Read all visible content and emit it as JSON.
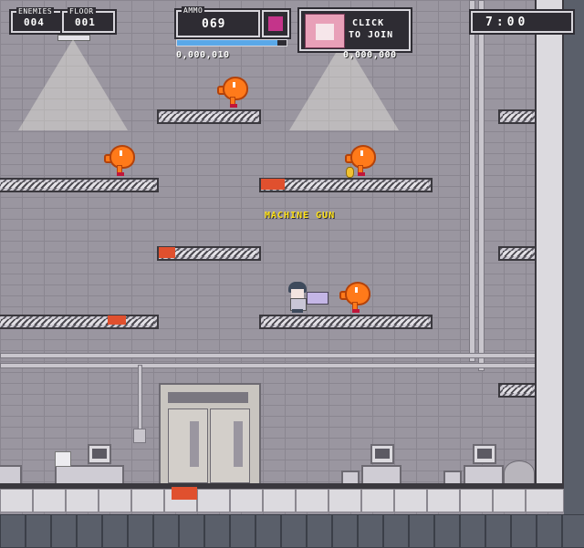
{
  "hud": {
    "enemies_label": "ENEMIES",
    "enemies_value": "004",
    "floor_label": "FLOOR",
    "floor_value": "001",
    "ammo_label": "AMMO",
    "ammo_value": "069",
    "player1_score": "0,000,010",
    "player2_score": "0,000,000",
    "join_line1": "CLICK",
    "join_line2": "TO JOIN",
    "timer_value": "7:00"
  },
  "game": {
    "weapon_pickup_label": "MACHINE GUN",
    "ammo_fraction": 0.92
  },
  "colors": {
    "enemy": "#ff7a1a",
    "blood": "#e0502e",
    "hud_bg": "#2e2c33",
    "ammo_bar": "#5aa8e8",
    "pickup_text": "#ffe21a",
    "p2_panel": "#e8a0b8"
  }
}
